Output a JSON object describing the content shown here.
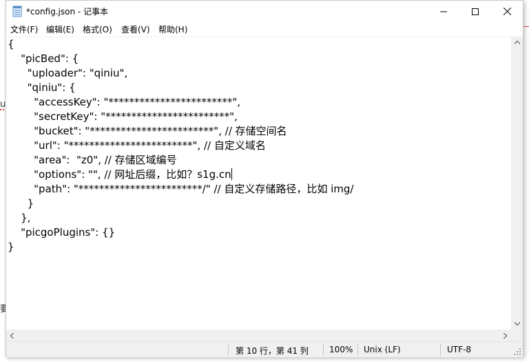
{
  "window": {
    "title": "*config.json - 记事本",
    "icon": "notepad-icon"
  },
  "menu": [
    {
      "label": "文件(F)"
    },
    {
      "label": "编辑(E)"
    },
    {
      "label": "格式(O)"
    },
    {
      "label": "查看(V)"
    },
    {
      "label": "帮助(H)"
    }
  ],
  "editor": {
    "lines": [
      "{",
      "    \"picBed\": {",
      "      \"uploader\": \"qiniu\",",
      "      \"qiniu\": {",
      "        \"accessKey\": \"************************\",",
      "        \"secretKey\": \"************************\",",
      "        \"bucket\": \"************************\", // 存储空间名",
      "        \"url\": \"************************\", // 自定义域名",
      "        \"area\":  \"z0\", // 存储区域编号",
      "        \"options\": \"\", // 网址后缀，比如？s1g.cn",
      "        \"path\": \"************************/\" // 自定义存储路径，比如 img/",
      "      }",
      "    },",
      "    \"picgoPlugins\": {}",
      "}"
    ]
  },
  "status": {
    "position": "第 10 行，第 41 列",
    "zoom": "100%",
    "line_ending": "Unix (LF)",
    "encoding": "UTF-8"
  },
  "background_fragments": [
    "u",
    "要"
  ]
}
